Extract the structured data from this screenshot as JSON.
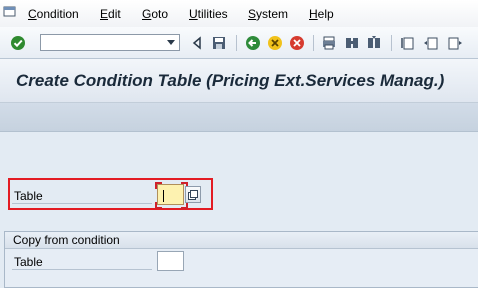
{
  "menubar": {
    "items": [
      {
        "label": "Condition",
        "underline": "C",
        "rest": "ondition"
      },
      {
        "label": "Edit",
        "underline": "E",
        "rest": "dit"
      },
      {
        "label": "Goto",
        "underline": "G",
        "rest": "oto"
      },
      {
        "label": "Utilities",
        "underline": "U",
        "rest": "tilities"
      },
      {
        "label": "System",
        "underline": "S",
        "rest": "ystem"
      },
      {
        "label": "Help",
        "underline": "H",
        "rest": "elp"
      }
    ]
  },
  "toolbar": {
    "command_field_value": "",
    "icons": [
      "enter-checkmark-icon",
      "command-dropdown-icon",
      "back-triangle-icon",
      "save-icon",
      "back-arrow-icon",
      "exit-icon",
      "cancel-icon",
      "print-icon",
      "find-icon",
      "find-next-icon",
      "first-page-icon",
      "previous-page-icon",
      "next-page-icon"
    ]
  },
  "title": "Create Condition Table (Pricing Ext.Services Manag.)",
  "form": {
    "table_label": "Table",
    "table_value": ""
  },
  "copy_group": {
    "title": "Copy from condition",
    "table_label": "Table",
    "table_value": ""
  },
  "colors": {
    "highlight": "#e31b23",
    "active_input": "#fdf2b0"
  }
}
